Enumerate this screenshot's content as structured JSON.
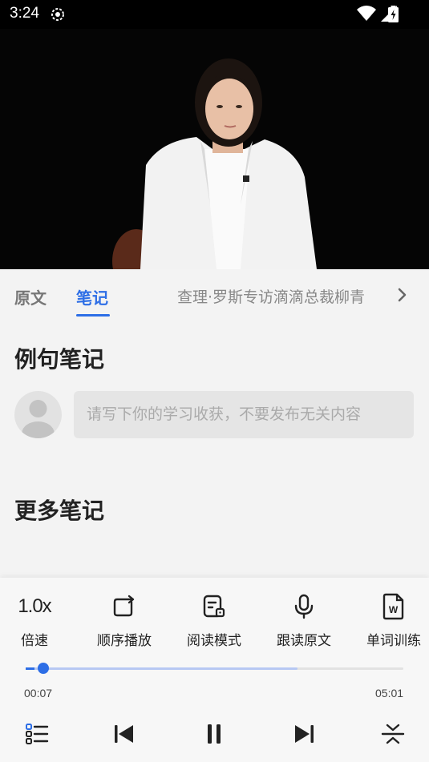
{
  "status": {
    "time": "3:24"
  },
  "tabs": {
    "original": "原文",
    "notes": "笔记",
    "title": "查理·罗斯专访滴滴总裁柳青"
  },
  "notes": {
    "example_heading": "例句笔记",
    "input_placeholder": "请写下你的学习收获，不要发布无关内容",
    "more_heading": "更多笔记"
  },
  "toolbar": {
    "speed_value": "1.0x",
    "speed_label": "倍速",
    "order_label": "顺序播放",
    "read_label": "阅读模式",
    "follow_label": "跟读原文",
    "word_label": "单词训练"
  },
  "player": {
    "current_time": "00:07",
    "total_time": "05:01",
    "progress": 0.023,
    "buffered": 0.72,
    "state": "playing"
  },
  "colors": {
    "accent": "#2d6ee6",
    "buffer": "#b7c8f3"
  }
}
